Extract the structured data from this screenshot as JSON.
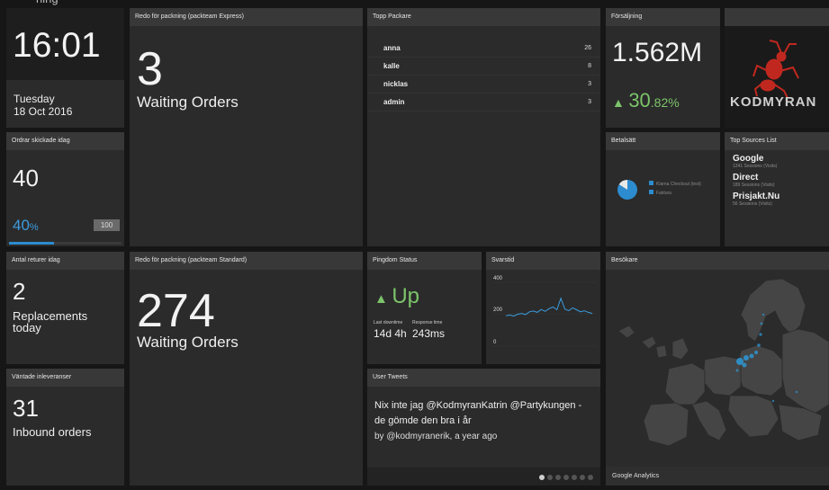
{
  "top_strip": "ning",
  "clock": {
    "time": "16:01",
    "day": "Tuesday",
    "date": "18 Oct 2016"
  },
  "express": {
    "title": "Redo för packning (packteam Express)",
    "value": "3",
    "label": "Waiting Orders"
  },
  "top_packers": {
    "title": "Topp Packare",
    "rows": [
      {
        "name": "anna",
        "count": "26"
      },
      {
        "name": "kalle",
        "count": "8"
      },
      {
        "name": "nicklas",
        "count": "3"
      },
      {
        "name": "admin",
        "count": "3"
      }
    ]
  },
  "sales": {
    "title": "Försäljning",
    "value": "1.562M",
    "change_int": "30",
    "change_dec": ".82%"
  },
  "logo": {
    "text": "KODMYRAN"
  },
  "shipped": {
    "title": "Ordrar skickade idag",
    "value": "40",
    "pct_num": "40",
    "pct_sym": "%",
    "goal": "100",
    "progress": 0.4
  },
  "payment": {
    "title": "Betalsätt",
    "legend": [
      "Klarna Checkout (test)",
      "Faktura"
    ],
    "slices": [
      0.84,
      0.16
    ]
  },
  "top_sources": {
    "title": "Top Sources List",
    "items": [
      {
        "name": "Google",
        "sub": "1241 Sessions (Visits)"
      },
      {
        "name": "Direct",
        "sub": "189 Sessions (Visits)"
      },
      {
        "name": "Prisjakt.Nu",
        "sub": "56 Sessions (Visits)"
      }
    ]
  },
  "returns": {
    "title": "Antal returer idag",
    "value": "2",
    "label_1": "Replacements",
    "label_2": "today"
  },
  "standard": {
    "title": "Redo för packning (packteam Standard)",
    "value": "274",
    "label": "Waiting Orders"
  },
  "pingdom": {
    "title": "Pingdom Status",
    "status": "Up",
    "downtime_label": "Last downtime",
    "downtime_value": "14d 4h",
    "response_label": "Response time",
    "response_value": "243ms"
  },
  "response_chart": {
    "title": "Svarstid",
    "ticks": [
      "400",
      "200",
      "0"
    ],
    "chart_data": {
      "type": "line",
      "ylim": [
        0,
        400
      ],
      "values": [
        190,
        195,
        188,
        200,
        205,
        198,
        215,
        220,
        212,
        230,
        218,
        235,
        245,
        228,
        300,
        232,
        222,
        240,
        228,
        215,
        222,
        212,
        205
      ]
    }
  },
  "visitors": {
    "title": "Besökare",
    "footer": "Google Analytics"
  },
  "inbound": {
    "title": "Väntade inleveranser",
    "value": "31",
    "label": "Inbound orders"
  },
  "tweets": {
    "title": "User Tweets",
    "text": "Nix inte jag @KodmyranKatrin @Partykungen - de gömde den bra i år",
    "by": "by @kodmyranerik, a year ago",
    "dots": 7
  },
  "colors": {
    "accent_blue": "#2d8ccf",
    "green": "#7cc46a",
    "tile_bg": "#2b2b2b",
    "title_bg": "#383838"
  }
}
